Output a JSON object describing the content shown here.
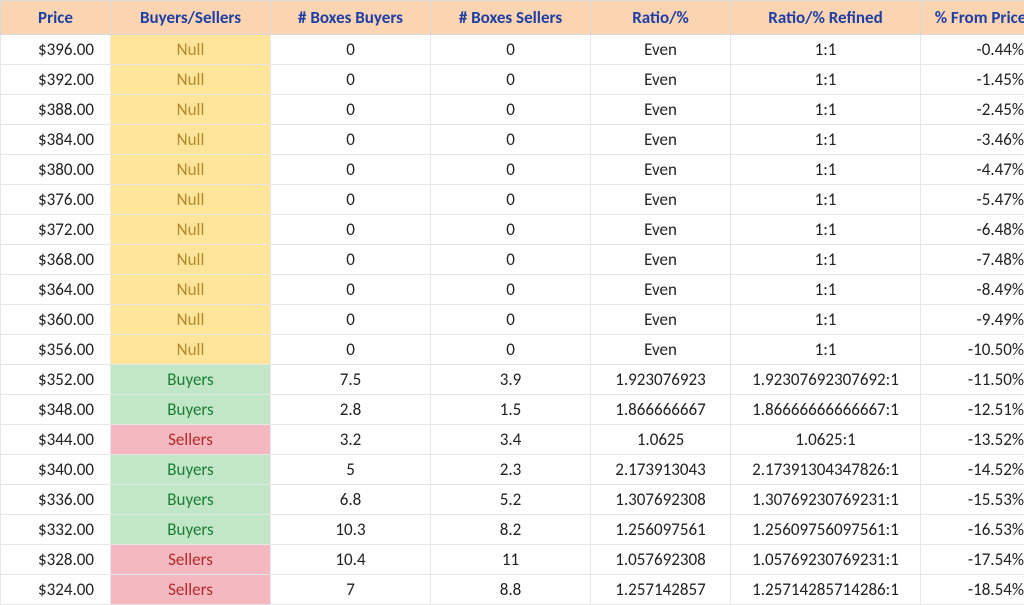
{
  "headers": {
    "price": "Price",
    "bs": "Buyers/Sellers",
    "boxes_buyers": "# Boxes Buyers",
    "boxes_sellers": "# Boxes Sellers",
    "ratio": "Ratio/%",
    "ratio_refined": "Ratio/% Refined",
    "pct_from_price": "% From Price"
  },
  "rows": [
    {
      "price": "$396.00",
      "bs": "Null",
      "bs_class": "null",
      "bb": "0",
      "bsell": "0",
      "ratio": "Even",
      "refined": "1:1",
      "pct": "-0.44%"
    },
    {
      "price": "$392.00",
      "bs": "Null",
      "bs_class": "null",
      "bb": "0",
      "bsell": "0",
      "ratio": "Even",
      "refined": "1:1",
      "pct": "-1.45%"
    },
    {
      "price": "$388.00",
      "bs": "Null",
      "bs_class": "null",
      "bb": "0",
      "bsell": "0",
      "ratio": "Even",
      "refined": "1:1",
      "pct": "-2.45%"
    },
    {
      "price": "$384.00",
      "bs": "Null",
      "bs_class": "null",
      "bb": "0",
      "bsell": "0",
      "ratio": "Even",
      "refined": "1:1",
      "pct": "-3.46%"
    },
    {
      "price": "$380.00",
      "bs": "Null",
      "bs_class": "null",
      "bb": "0",
      "bsell": "0",
      "ratio": "Even",
      "refined": "1:1",
      "pct": "-4.47%"
    },
    {
      "price": "$376.00",
      "bs": "Null",
      "bs_class": "null",
      "bb": "0",
      "bsell": "0",
      "ratio": "Even",
      "refined": "1:1",
      "pct": "-5.47%"
    },
    {
      "price": "$372.00",
      "bs": "Null",
      "bs_class": "null",
      "bb": "0",
      "bsell": "0",
      "ratio": "Even",
      "refined": "1:1",
      "pct": "-6.48%"
    },
    {
      "price": "$368.00",
      "bs": "Null",
      "bs_class": "null",
      "bb": "0",
      "bsell": "0",
      "ratio": "Even",
      "refined": "1:1",
      "pct": "-7.48%"
    },
    {
      "price": "$364.00",
      "bs": "Null",
      "bs_class": "null",
      "bb": "0",
      "bsell": "0",
      "ratio": "Even",
      "refined": "1:1",
      "pct": "-8.49%"
    },
    {
      "price": "$360.00",
      "bs": "Null",
      "bs_class": "null",
      "bb": "0",
      "bsell": "0",
      "ratio": "Even",
      "refined": "1:1",
      "pct": "-9.49%"
    },
    {
      "price": "$356.00",
      "bs": "Null",
      "bs_class": "null",
      "bb": "0",
      "bsell": "0",
      "ratio": "Even",
      "refined": "1:1",
      "pct": "-10.50%"
    },
    {
      "price": "$352.00",
      "bs": "Buyers",
      "bs_class": "buyers",
      "bb": "7.5",
      "bsell": "3.9",
      "ratio": "1.923076923",
      "refined": "1.92307692307692:1",
      "pct": "-11.50%"
    },
    {
      "price": "$348.00",
      "bs": "Buyers",
      "bs_class": "buyers",
      "bb": "2.8",
      "bsell": "1.5",
      "ratio": "1.866666667",
      "refined": "1.86666666666667:1",
      "pct": "-12.51%"
    },
    {
      "price": "$344.00",
      "bs": "Sellers",
      "bs_class": "sellers",
      "bb": "3.2",
      "bsell": "3.4",
      "ratio": "1.0625",
      "refined": "1.0625:1",
      "pct": "-13.52%"
    },
    {
      "price": "$340.00",
      "bs": "Buyers",
      "bs_class": "buyers",
      "bb": "5",
      "bsell": "2.3",
      "ratio": "2.173913043",
      "refined": "2.17391304347826:1",
      "pct": "-14.52%"
    },
    {
      "price": "$336.00",
      "bs": "Buyers",
      "bs_class": "buyers",
      "bb": "6.8",
      "bsell": "5.2",
      "ratio": "1.307692308",
      "refined": "1.30769230769231:1",
      "pct": "-15.53%"
    },
    {
      "price": "$332.00",
      "bs": "Buyers",
      "bs_class": "buyers",
      "bb": "10.3",
      "bsell": "8.2",
      "ratio": "1.256097561",
      "refined": "1.25609756097561:1",
      "pct": "-16.53%"
    },
    {
      "price": "$328.00",
      "bs": "Sellers",
      "bs_class": "sellers",
      "bb": "10.4",
      "bsell": "11",
      "ratio": "1.057692308",
      "refined": "1.05769230769231:1",
      "pct": "-17.54%"
    },
    {
      "price": "$324.00",
      "bs": "Sellers",
      "bs_class": "sellers",
      "bb": "7",
      "bsell": "8.8",
      "ratio": "1.257142857",
      "refined": "1.25714285714286:1",
      "pct": "-18.54%"
    }
  ]
}
